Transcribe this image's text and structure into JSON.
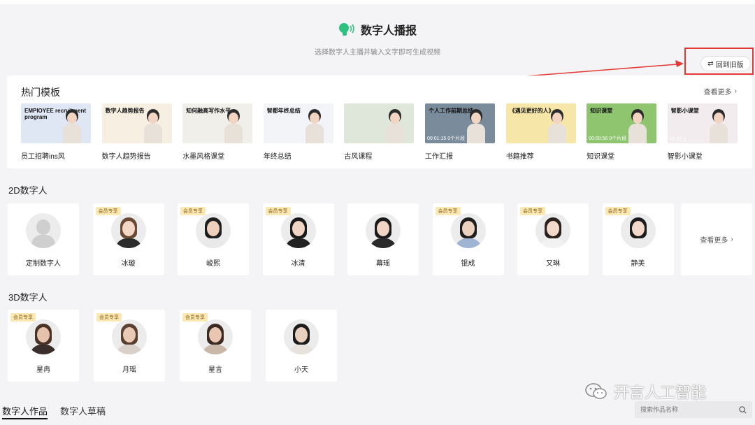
{
  "header": {
    "title": "数字人播报",
    "subtitle": "选择数字人主播并输入文字即可生成视频",
    "old_version_button": "回到旧版"
  },
  "hot_templates": {
    "title": "热门模板",
    "more_label": "查看更多",
    "items": [
      {
        "label": "员工招聘ins风",
        "thumb_text": "EMPIOYEE recruitment program",
        "bg": "#dfe6f4"
      },
      {
        "label": "数字人趋势报告",
        "thumb_text": "数字人趋势报告",
        "bg": "#f6efe2"
      },
      {
        "label": "水墨风格课堂",
        "thumb_text": "知何融高写作水平",
        "bg": "#f1efe9"
      },
      {
        "label": "年终总结",
        "thumb_text": "智都年终总结",
        "bg": "#f2f4f8"
      },
      {
        "label": "古风课程",
        "thumb_text": "",
        "bg": "#dfe7da"
      },
      {
        "label": "工作汇报",
        "thumb_text": "个人工作前期总结",
        "time": "00:01:15 0个片段",
        "bg": "#7a8c9c"
      },
      {
        "label": "书籍推荐",
        "thumb_text": "《遇见更好的人》",
        "bg": "#f6e7a8"
      },
      {
        "label": "知识课堂",
        "thumb_text": "知识课堂",
        "time": "00:00:56 0个片段",
        "bg": "#8ec56e"
      },
      {
        "label": "智影小课堂",
        "thumb_text": "智影小课堂",
        "time": "00:31 0",
        "bg": "#f2ecef"
      }
    ]
  },
  "section_2d": {
    "title": "2D数字人",
    "badge": "会员专享",
    "more_label": "查看更多",
    "items": [
      {
        "name": "定制数字人",
        "vip": false,
        "custom": true,
        "skin": "#d6d6d6",
        "hair": "#bfbfbf",
        "cloth": "#c8c8c8"
      },
      {
        "name": "冰璇",
        "vip": true,
        "skin": "#f2d7c6",
        "hair": "#6b4a35",
        "cloth": "#2c2c2c"
      },
      {
        "name": "峻熙",
        "vip": true,
        "skin": "#ecd0bc",
        "hair": "#1e1e1e",
        "cloth": "#e9e9e9"
      },
      {
        "name": "冰清",
        "vip": true,
        "skin": "#f0d5c5",
        "hair": "#1a1a1a",
        "cloth": "#222222"
      },
      {
        "name": "幕瑶",
        "vip": false,
        "skin": "#f1d6c6",
        "hair": "#1a1a1a",
        "cloth": "#2a2a2a"
      },
      {
        "name": "锟成",
        "vip": true,
        "skin": "#ecd2be",
        "hair": "#1e1e1e",
        "cloth": "#9fb3d3"
      },
      {
        "name": "又琳",
        "vip": true,
        "skin": "#f2d9ca",
        "hair": "#2a211c",
        "cloth": "#f2f2f2"
      },
      {
        "name": "静美",
        "vip": true,
        "skin": "#f3d9c9",
        "hair": "#1c1c1c",
        "cloth": "#ececec"
      }
    ]
  },
  "section_3d": {
    "title": "3D数字人",
    "badge": "会员专享",
    "items": [
      {
        "name": "星冉",
        "vip": true,
        "skin": "#e6c2ad",
        "hair": "#4a3326",
        "cloth": "#3a2e2a"
      },
      {
        "name": "月瑶",
        "vip": true,
        "skin": "#eac9b5",
        "hair": "#5a4030",
        "cloth": "#d9d0c9"
      },
      {
        "name": "星言",
        "vip": true,
        "skin": "#e8c6b2",
        "hair": "#3b2a22",
        "cloth": "#c9b8a8"
      },
      {
        "name": "小天",
        "vip": false,
        "skin": "#ead0bf",
        "hair": "#1c1c1c",
        "cloth": "#e7e2dc"
      }
    ]
  },
  "bottom": {
    "tabs": [
      "数字人作品",
      "数字人草稿"
    ],
    "search_placeholder": "搜索作品名称"
  },
  "watermark": "开言人工智能",
  "colors": {
    "highlight_red": "#e53935",
    "accent_green": "#2ec27e",
    "vip_badge_bg": "#fbe9b5"
  }
}
